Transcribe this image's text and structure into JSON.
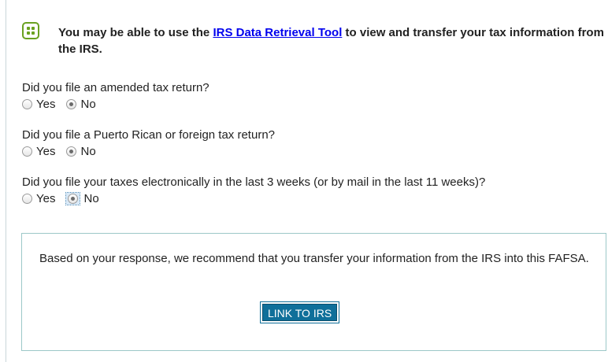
{
  "notice": {
    "text_before": "You may be able to use the ",
    "link_text": "IRS Data Retrieval Tool",
    "text_after": " to view and transfer your tax information from the IRS."
  },
  "questions": [
    {
      "text": "Did you file an amended tax return?",
      "options": [
        "Yes",
        "No"
      ],
      "selected": "No"
    },
    {
      "text": "Did you file a Puerto Rican or foreign tax return?",
      "options": [
        "Yes",
        "No"
      ],
      "selected": "No"
    },
    {
      "text": "Did you file your taxes electronically in the last 3 weeks (or by mail in the last 11 weeks)?",
      "options": [
        "Yes",
        "No"
      ],
      "selected": "No"
    }
  ],
  "recommendation": {
    "text": "Based on your response, we recommend that you transfer your information from the IRS into this FAFSA.",
    "button_label": "LINK TO IRS"
  },
  "colors": {
    "icon_green": "#6aa121",
    "button_blue": "#0f6f9a",
    "box_border": "#9cc8c8"
  },
  "icons": {
    "notice": "info-dots-icon"
  }
}
